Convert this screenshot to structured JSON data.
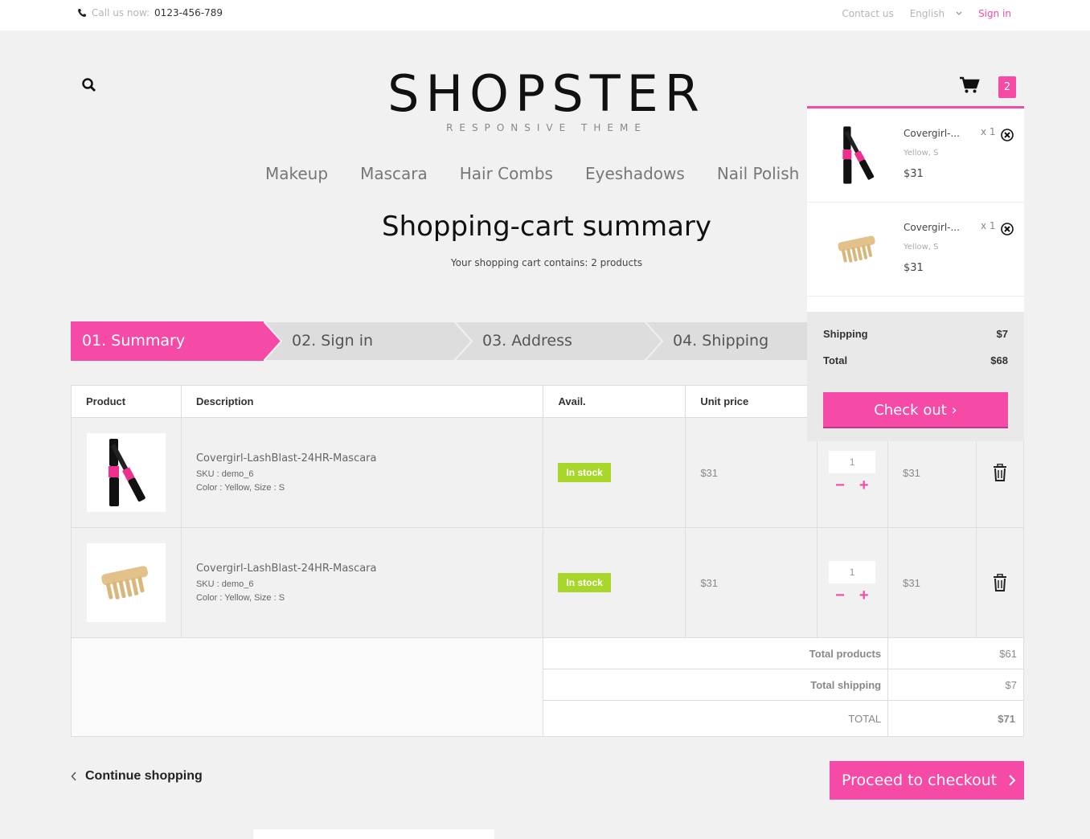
{
  "topbar": {
    "call_label": "Call us now:",
    "phone": "0123-456-789",
    "contact": "Contact us",
    "language": "English",
    "signin": "Sign in"
  },
  "header": {
    "logo": "SHOPSTER",
    "tagline": "RESPONSIVE THEME",
    "cart_count": "2"
  },
  "nav": [
    "Makeup",
    "Mascara",
    "Hair Combs",
    "Eyeshadows",
    "Nail Polish"
  ],
  "page": {
    "title": "Shopping-cart summary",
    "subtitle": "Your shopping cart contains: 2 products"
  },
  "steps": [
    "01. Summary",
    "02. Sign in",
    "03. Address",
    "04. Shipping"
  ],
  "table": {
    "headers": [
      "Product",
      "Description",
      "Avail.",
      "Unit price"
    ],
    "rows": [
      {
        "name": "Covergirl-LashBlast-24HR-Mascara",
        "sku": "SKU : demo_6",
        "attrs": "Color : Yellow, Size : S",
        "avail": "In stock",
        "unit_price": "$31",
        "qty": "1",
        "total": "$31"
      },
      {
        "name": "Covergirl-LashBlast-24HR-Mascara",
        "sku": "SKU : demo_6",
        "attrs": "Color : Yellow, Size : S",
        "avail": "In stock",
        "unit_price": "$31",
        "qty": "1",
        "total": "$31"
      }
    ],
    "total_products_label": "Total products",
    "total_products": "$61",
    "total_shipping_label": "Total shipping",
    "total_shipping": "$7",
    "total_label": "TOTAL",
    "total": "$71"
  },
  "actions": {
    "continue": "Continue shopping",
    "proceed": "Proceed to checkout"
  },
  "minicart": {
    "items": [
      {
        "name": "Covergirl-...",
        "attrs": "Yellow, S",
        "price": "$31",
        "qty": "x 1"
      },
      {
        "name": "Covergirl-...",
        "attrs": "Yellow, S",
        "price": "$31",
        "qty": "x 1"
      }
    ],
    "shipping_label": "Shipping",
    "shipping": "$7",
    "total_label": "Total",
    "total": "$68",
    "checkout": "Check out"
  },
  "colors": {
    "accent": "#f54aa6",
    "stock": "#a8d62a"
  }
}
